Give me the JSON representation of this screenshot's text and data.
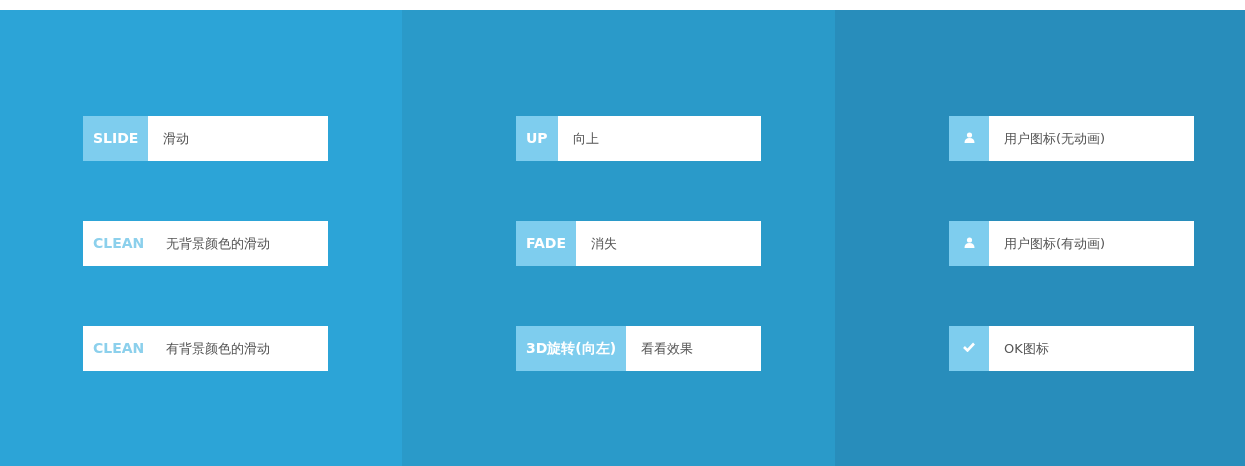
{
  "columns": [
    {
      "buttons": [
        {
          "kind": "tag",
          "tag": "SLIDE",
          "text": "滑动"
        },
        {
          "kind": "clean",
          "tag": "CLEAN",
          "text": "无背景颜色的滑动"
        },
        {
          "kind": "clean",
          "tag": "CLEAN",
          "text": "有背景颜色的滑动"
        }
      ]
    },
    {
      "buttons": [
        {
          "kind": "tag",
          "tag": "UP",
          "text": "向上"
        },
        {
          "kind": "tag",
          "tag": "FADE",
          "text": "消失"
        },
        {
          "kind": "tag",
          "tag": "3D旋转(向左)",
          "text": "看看效果"
        }
      ]
    },
    {
      "buttons": [
        {
          "kind": "user",
          "text": "用户图标(无动画)"
        },
        {
          "kind": "user",
          "text": "用户图标(有动画)"
        },
        {
          "kind": "check",
          "text": "OK图标"
        }
      ]
    }
  ]
}
